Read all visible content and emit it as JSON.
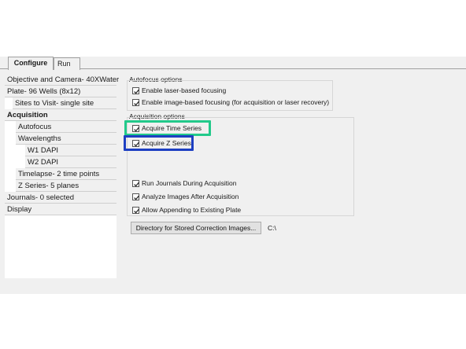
{
  "tabs": [
    {
      "label": "Configure",
      "active": true
    },
    {
      "label": "Run",
      "active": false
    }
  ],
  "sidebar": {
    "items": [
      {
        "label": "Objective and Camera- 40XWater",
        "level": 0
      },
      {
        "label": "Plate- 96 Wells (8x12)",
        "level": 0
      },
      {
        "label": "Sites to Visit- single site",
        "level": 1
      },
      {
        "label": "Acquisition",
        "level": 0,
        "selected": true
      },
      {
        "label": "Autofocus",
        "level": 1
      },
      {
        "label": "Wavelengths",
        "level": 1
      },
      {
        "label": "W1 DAPI",
        "level": 2
      },
      {
        "label": "W2 DAPI",
        "level": 2
      },
      {
        "label": "Timelapse- 2 time points",
        "level": 1
      },
      {
        "label": "Z Series- 5 planes",
        "level": 1
      },
      {
        "label": "Journals- 0 selected",
        "level": 0
      },
      {
        "label": "Display",
        "level": 0
      }
    ]
  },
  "autofocus": {
    "title": "Autofocus options",
    "options": [
      {
        "label": "Enable laser-based focusing",
        "checked": true
      },
      {
        "label": "Enable image-based focusing (for acquisition or laser recovery)",
        "checked": true
      }
    ]
  },
  "acquisition": {
    "title": "Acquisition options",
    "options": [
      {
        "label": "Acquire Time Series",
        "checked": true
      },
      {
        "label": "Acquire Z Series",
        "checked": true
      },
      {
        "label": "Run Journals During Acquisition",
        "checked": true
      },
      {
        "label": "Analyze Images After Acquisition",
        "checked": true
      },
      {
        "label": "Allow Appending to Existing Plate",
        "checked": true
      }
    ]
  },
  "correction": {
    "button_label": "Directory for Stored Correction Images...",
    "path": "C:\\"
  },
  "colors": {
    "highlight_time_series": "#22c98a",
    "highlight_z_series": "#1d3fc2"
  }
}
